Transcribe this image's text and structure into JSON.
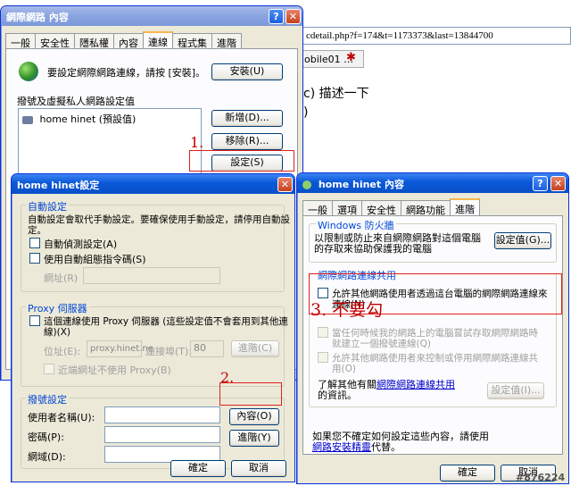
{
  "browser": {
    "url": "cdetail.php?f=174&t=1173373&last=13844700",
    "tab_label": "obile01 …",
    "content_line1": "c) 描述一下",
    "content_line2": ")"
  },
  "inet": {
    "title": "網際網路 內容",
    "tabs": [
      "一般",
      "安全性",
      "隱私權",
      "內容",
      "連線",
      "程式集",
      "進階"
    ],
    "setup_text": "要設定網際網路連線，請按 [安裝]。",
    "setup_button": "安裝(U)",
    "vpn_label": "撥號及虛擬私人網路設定值",
    "list_item": "home hinet (預設值)",
    "add_button": "新增(D)...",
    "remove_button": "移除(R)...",
    "settings_button": "設定(S)"
  },
  "hinet": {
    "title": "home hinet設定",
    "auto_group": "自動設定",
    "auto_desc_1": "自動設定會取代手動設定。要確保使用手動設定，請停用自動設",
    "auto_desc_2": "定。",
    "auto_detect": "自動偵測設定(A)",
    "auto_script": "使用自動組態指令碼(S)",
    "address_label": "網址(R)",
    "proxy_group": "Proxy 伺服器",
    "proxy_desc_1": "這個連線使用 Proxy 伺服器 (這些設定值不會套用到其他連",
    "proxy_desc_2": "線)(X)",
    "proxy_addr_label": "位址(E):",
    "proxy_addr_value": "proxy.hinet.ne",
    "port_label": "連接埠(T):",
    "port_value": "80",
    "advanced_button": "進階(C)",
    "bypass_label": "近端網址不使用 Proxy(B)",
    "dial_group": "撥號設定",
    "username_label": "使用者名稱(U):",
    "password_label": "密碼(P):",
    "domain_label": "網域(D):",
    "properties_button": "內容(O)",
    "advanced_y_button": "進階(Y)",
    "ok_button": "確定",
    "cancel_button": "取消"
  },
  "props": {
    "title": "home hinet 內容",
    "tabs": [
      "一般",
      "選項",
      "安全性",
      "網路功能",
      "進階"
    ],
    "firewall_group": "Windows 防火牆",
    "firewall_desc_1": "以限制或防止來自網際網路對這個電腦",
    "firewall_desc_2": "的存取來協助保護我的電腦",
    "firewall_button": "設定值(G)...",
    "ics_group": "網際網路連線共用",
    "ics_allow_1": "允許其他網路使用者透過這台電腦的網際網路連線來",
    "ics_allow_2": "連線(N)",
    "ics_dial_1": "當任何時候我的網路上的電腦嘗試存取網際網路時",
    "ics_dial_2": "就建立一個撥號連線(Q)",
    "ics_control_1": "允許其他網路使用者來控制或停用網際網路連線共",
    "ics_control_2": "用(O)",
    "learn_more_prefix": "了解其他有關",
    "learn_more_link": "網際網路連線共用",
    "learn_more_suffix": "的資訊。",
    "ics_settings_button": "設定值(I)...",
    "footer_1": "如果您不確定如何設定這些內容，請使用",
    "footer_link": "網路安裝精靈",
    "footer_2": "代替。",
    "ok_button": "確定",
    "cancel_button": "取消"
  },
  "annotations": {
    "step1": "1.",
    "step2": "2.",
    "step3": "3. 不要勾",
    "watermark": "#876224"
  },
  "colors": {
    "annotation_red": "#c00000",
    "xp_blue": "#0a58d8",
    "group_blue": "#0046d5"
  }
}
